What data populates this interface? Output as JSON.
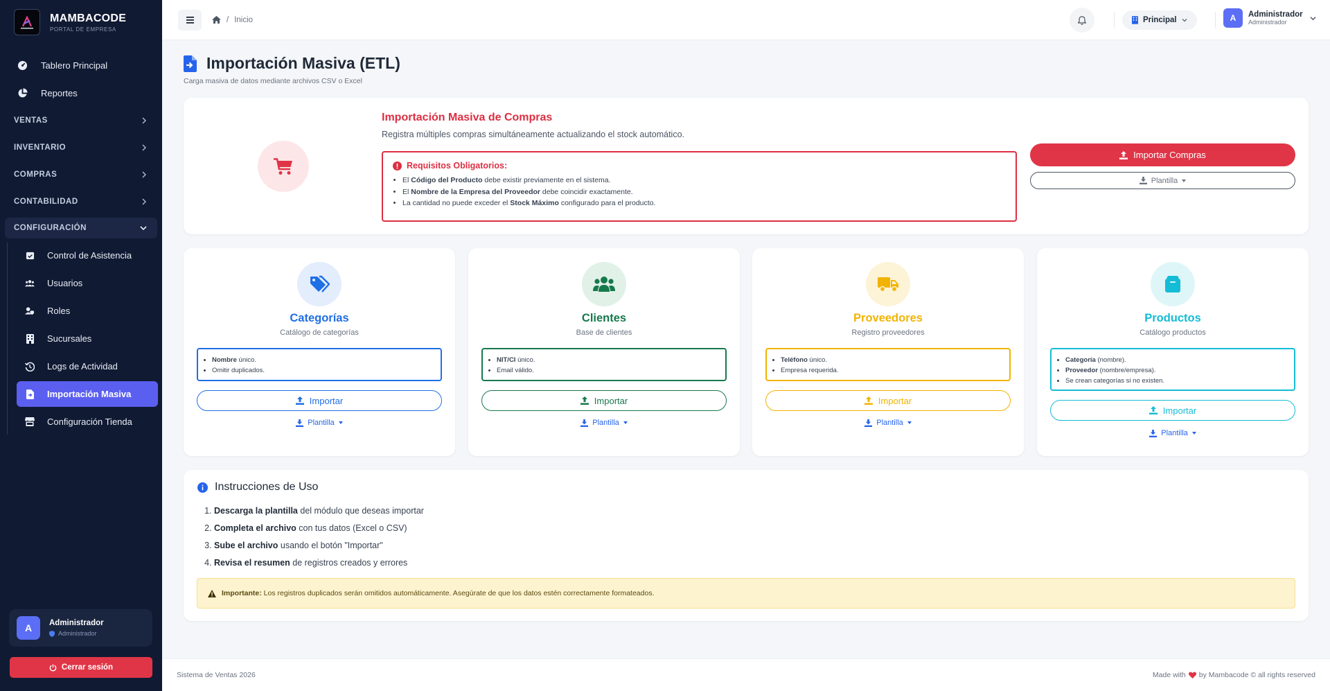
{
  "brand": {
    "name": "MAMBACODE",
    "subtitle": "PORTAL DE EMPRESA"
  },
  "sidebar": {
    "main_items": [
      {
        "label": "Tablero Principal",
        "icon": "gauge-icon"
      },
      {
        "label": "Reportes",
        "icon": "pie-chart-icon"
      }
    ],
    "sections": [
      {
        "label": "VENTAS"
      },
      {
        "label": "INVENTARIO"
      },
      {
        "label": "COMPRAS"
      },
      {
        "label": "CONTABILIDAD"
      },
      {
        "label": "CONFIGURACIÓN",
        "open": true
      }
    ],
    "config_items": [
      {
        "label": "Control de Asistencia",
        "icon": "calendar-check-icon"
      },
      {
        "label": "Usuarios",
        "icon": "users-icon"
      },
      {
        "label": "Roles",
        "icon": "user-shield-icon"
      },
      {
        "label": "Sucursales",
        "icon": "building-icon"
      },
      {
        "label": "Logs de Actividad",
        "icon": "history-icon"
      },
      {
        "label": "Importación Masiva",
        "icon": "file-import-icon",
        "active": true
      },
      {
        "label": "Configuración Tienda",
        "icon": "store-icon"
      }
    ],
    "user": {
      "initial": "A",
      "name": "Administrador",
      "role": "Administrador"
    },
    "logout_label": "Cerrar sesión"
  },
  "topbar": {
    "breadcrumb": {
      "separator": "/",
      "current": "Inicio"
    },
    "branch": "Principal",
    "user": {
      "initial": "A",
      "name": "Administrador",
      "role": "Administrador"
    }
  },
  "page": {
    "title": "Importación Masiva (ETL)",
    "subtitle": "Carga masiva de datos mediante archivos CSV o Excel"
  },
  "hero": {
    "title": "Importación Masiva de Compras",
    "subtitle": "Registra múltiples compras simultáneamente actualizando el stock automático.",
    "requirements_title": "Requisitos Obligatorios:",
    "requirements": [
      {
        "pre": "El ",
        "bold": "Código del Producto",
        "post": " debe existir previamente en el sistema."
      },
      {
        "pre": "El ",
        "bold": "Nombre de la Empresa del Proveedor",
        "post": " debe coincidir exactamente."
      },
      {
        "pre": "La cantidad no puede exceder el ",
        "bold": "Stock Máximo",
        "post": " configurado para el producto."
      }
    ],
    "import_label": "Importar Compras",
    "template_label": "Plantilla",
    "color": "#dc2f42"
  },
  "modules": [
    {
      "title": "Categorías",
      "subtitle": "Catálogo de categorías",
      "color": "#1f6fe5",
      "bg": "#e3edfc",
      "icon": "tags-icon",
      "rules": [
        {
          "bold": "Nombre",
          "post": " único."
        },
        {
          "bold": "",
          "post": "Omitir duplicados."
        }
      ],
      "import_label": "Importar",
      "template_label": "Plantilla"
    },
    {
      "title": "Clientes",
      "subtitle": "Base de clientes",
      "color": "#16794c",
      "bg": "#e1f1e8",
      "icon": "users-icon",
      "rules": [
        {
          "bold": "NIT/CI",
          "post": " único."
        },
        {
          "bold": "",
          "post": "Email válido."
        }
      ],
      "import_label": "Importar",
      "template_label": "Plantilla"
    },
    {
      "title": "Proveedores",
      "subtitle": "Registro proveedores",
      "color": "#f2b300",
      "bg": "#fdf3d6",
      "icon": "truck-icon",
      "rules": [
        {
          "bold": "Teléfono",
          "post": " único."
        },
        {
          "bold": "",
          "post": "Empresa requerida."
        }
      ],
      "import_label": "Importar",
      "template_label": "Plantilla"
    },
    {
      "title": "Productos",
      "subtitle": "Catálogo productos",
      "color": "#14bcd6",
      "bg": "#dff6f9",
      "icon": "box-icon",
      "rules": [
        {
          "bold": "Categoría",
          "post": " (nombre)."
        },
        {
          "bold": "Proveedor",
          "post": " (nombre/empresa)."
        },
        {
          "bold": "",
          "post": "Se crean categorías si no existen."
        }
      ],
      "import_label": "Importar",
      "template_label": "Plantilla"
    }
  ],
  "instructions": {
    "title": "Instrucciones de Uso",
    "steps": [
      {
        "bold": "Descarga la plantilla",
        "post": " del módulo que deseas importar"
      },
      {
        "bold": "Completa el archivo",
        "post": " con tus datos (Excel o CSV)"
      },
      {
        "bold": "Sube el archivo",
        "post": " usando el botón \"Importar\""
      },
      {
        "bold": "Revisa el resumen",
        "post": " de registros creados y errores"
      }
    ],
    "alert_bold": "Importante:",
    "alert_text": " Los registros duplicados serán omitidos automáticamente. Asegúrate de que los datos estén correctamente formateados."
  },
  "footer": {
    "left": "Sistema de Ventas 2026",
    "right_pre": "Made with",
    "right_post": "by Mambacode © all rights reserved"
  }
}
